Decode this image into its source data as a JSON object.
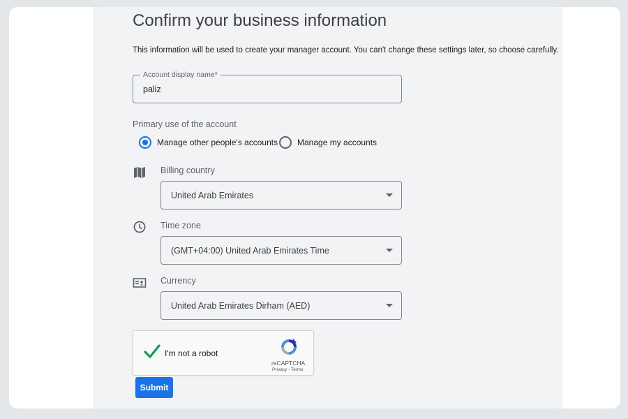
{
  "page": {
    "title": "Confirm your business information",
    "description": "This information will be used to create your manager account. You can't change these settings later, so choose carefully."
  },
  "account_name": {
    "label": "Account display name*",
    "value": "paliz"
  },
  "primary_use": {
    "label": "Primary use of the account",
    "options": [
      {
        "label": "Manage other people's accounts",
        "checked": true
      },
      {
        "label": "Manage my accounts",
        "checked": false
      }
    ]
  },
  "billing_country": {
    "icon": "map-icon",
    "label": "Billing country",
    "value": "United Arab Emirates"
  },
  "time_zone": {
    "icon": "clock-icon",
    "label": "Time zone",
    "value": "(GMT+04:00) United Arab Emirates Time"
  },
  "currency": {
    "icon": "currency-card-icon",
    "label": "Currency",
    "value": "United Arab Emirates Dirham (AED)"
  },
  "captcha": {
    "label": "I'm not a robot",
    "checked": true,
    "brand": "reCAPTCHA",
    "links": "Privacy - Terms"
  },
  "submit": {
    "label": "Submit"
  },
  "colors": {
    "accent": "#1a73e8",
    "panel_bg": "#f1f3f4",
    "check_green": "#0f9d58"
  }
}
